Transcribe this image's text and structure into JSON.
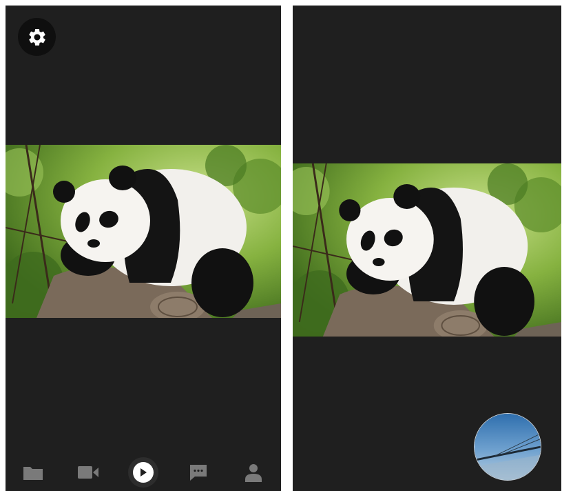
{
  "screens": [
    {
      "id": "camera-preview",
      "settings_icon": "gear-icon",
      "photo": {
        "subject": "panda-photo"
      },
      "tabbar": {
        "tabs": [
          {
            "icon": "folder-icon",
            "active": false
          },
          {
            "icon": "video-camera-icon",
            "active": false
          },
          {
            "icon": "play-icon",
            "active": true
          },
          {
            "icon": "chat-icon",
            "active": false
          },
          {
            "icon": "person-icon",
            "active": false
          }
        ]
      }
    },
    {
      "id": "photo-view",
      "photo": {
        "subject": "panda-photo"
      },
      "thumbnail": {
        "subject": "sky-bridge-thumbnail"
      }
    }
  ],
  "colors": {
    "background": "#1f1f1f",
    "tab_icon": "#8a8a8a",
    "active_tab": "#ffffff"
  }
}
